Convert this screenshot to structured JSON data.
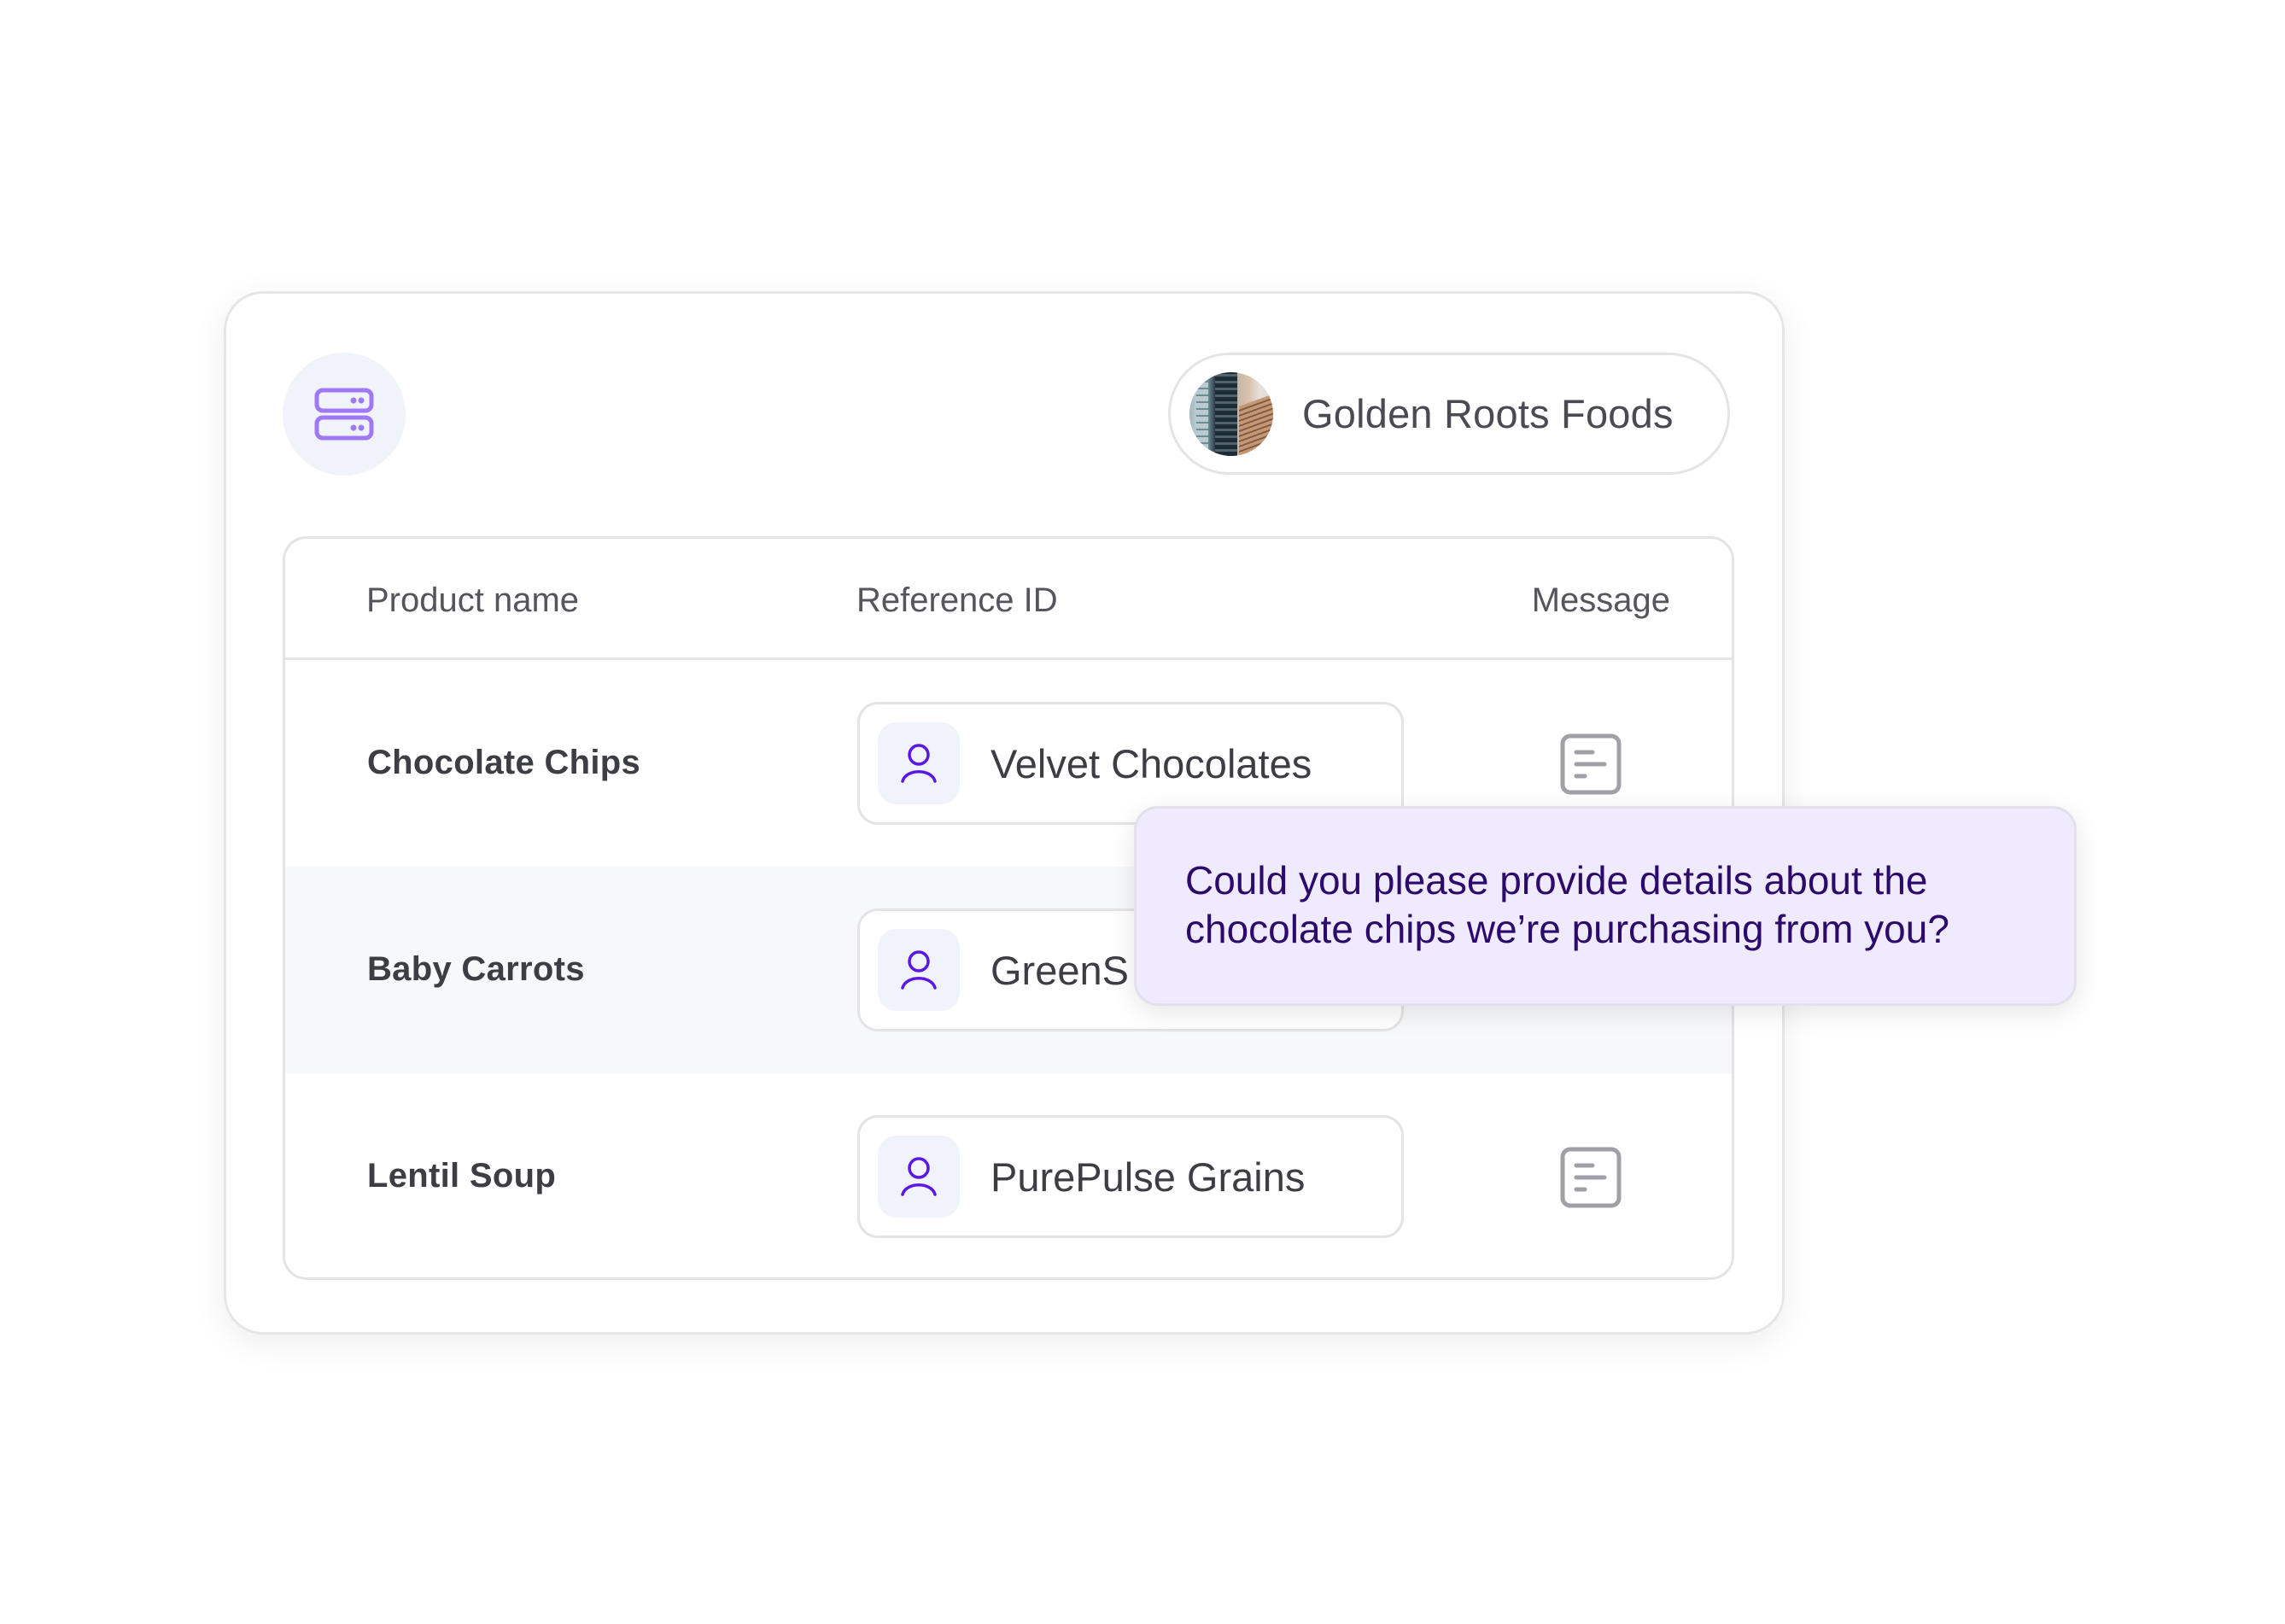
{
  "header": {
    "app_icon": "server-stack-icon",
    "company": {
      "name": "Golden Roots Foods",
      "avatar": "building-photo"
    }
  },
  "table": {
    "columns": [
      "Product name",
      "Reference ID",
      "Message"
    ],
    "rows": [
      {
        "product": "Chocolate Chips",
        "reference": "Velvet Chocolates",
        "message_icon": "message-doc-icon",
        "shaded": false
      },
      {
        "product": "Baby Carrots",
        "reference": "GreenS",
        "message_icon": "message-doc-icon",
        "shaded": true
      },
      {
        "product": "Lentil Soup",
        "reference": "PurePulse Grains",
        "message_icon": "message-doc-icon",
        "shaded": false
      }
    ]
  },
  "tooltip": {
    "text": "Could you please provide details about the chocolate chips we’re purchasing from you?"
  },
  "colors": {
    "accent_icon": "#a078f5",
    "user_icon": "#5b17e6",
    "tooltip_bg": "#efeafd",
    "tooltip_text": "#2b0a6b",
    "muted_icon": "#a0a0a6"
  }
}
